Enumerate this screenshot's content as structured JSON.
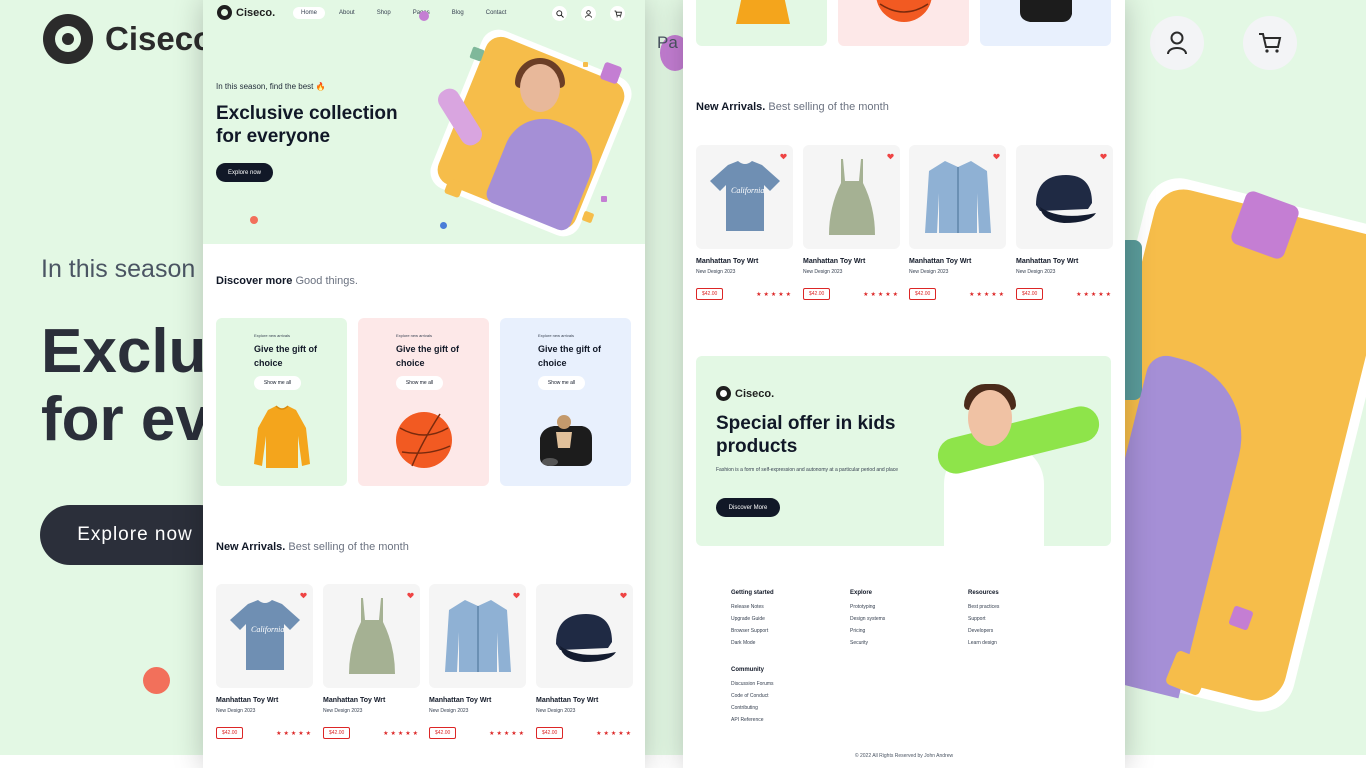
{
  "background": {
    "logo_text": "Ciseco",
    "nav_partial": "Pa",
    "season_text": "In this season",
    "title_lines": [
      "Exclus",
      "for ev"
    ],
    "explore_label": "Explore now",
    "icons": [
      "user-icon",
      "cart-icon"
    ]
  },
  "page_a": {
    "logo_text": "Ciseco.",
    "nav": [
      "Home",
      "About",
      "Shop",
      "Pages",
      "Blog",
      "Contact"
    ],
    "hero": {
      "season": "In this season, find the best 🔥",
      "title": "Exclusive collection for everyone",
      "button": "Explore now"
    },
    "discover": {
      "title": "Discover more",
      "sub": "Good things."
    },
    "gift_cards": [
      {
        "small": "Explore new arrivals",
        "title": "Give the gift of choice",
        "button": "Show me all",
        "image": "sweater",
        "color": "#e3f8e4"
      },
      {
        "small": "Explore new arrivals",
        "title": "Give the gift of choice",
        "button": "Show me all",
        "image": "basketball",
        "color": "#fde8e8"
      },
      {
        "small": "Explore new arrivals",
        "title": "Give the gift of choice",
        "button": "Show me all",
        "image": "pet-carrier",
        "color": "#e8f0fd"
      }
    ],
    "arrivals": {
      "title": "New Arrivals.",
      "sub": "Best selling of the month"
    },
    "products": [
      {
        "name": "Manhattan Toy Wrt",
        "sub": "New Design 2023",
        "price": "$42.00",
        "stars": "★★★★★",
        "image": "tshirt"
      },
      {
        "name": "Manhattan Toy Wrt",
        "sub": "New Design 2023",
        "price": "$42.00",
        "stars": "★★★★★",
        "image": "dress"
      },
      {
        "name": "Manhattan Toy Wrt",
        "sub": "New Design 2023",
        "price": "$42.00",
        "stars": "★★★★★",
        "image": "denim-jacket"
      },
      {
        "name": "Manhattan Toy Wrt",
        "sub": "New Design 2023",
        "price": "$42.00",
        "stars": "★★★★★",
        "image": "cap"
      }
    ]
  },
  "page_b": {
    "arrivals": {
      "title": "New Arrivals.",
      "sub": "Best selling of the month"
    },
    "products": [
      {
        "name": "Manhattan Toy Wrt",
        "sub": "New Design 2023",
        "price": "$42.00",
        "stars": "★★★★★"
      },
      {
        "name": "Manhattan Toy Wrt",
        "sub": "New Design 2023",
        "price": "$42.00",
        "stars": "★★★★★"
      },
      {
        "name": "Manhattan Toy Wrt",
        "sub": "New Design 2023",
        "price": "$42.00",
        "stars": "★★★★★"
      },
      {
        "name": "Manhattan Toy Wrt",
        "sub": "New Design 2023",
        "price": "$42.00",
        "stars": "★★★★★"
      }
    ],
    "kids": {
      "logo_text": "Ciseco.",
      "title": "Special offer in kids products",
      "text": "Fashion is a form of self-expression and autonomy at a particular period and place",
      "button": "Discover More"
    },
    "footer": {
      "getting_started": {
        "title": "Getting started",
        "links": [
          "Release Notes",
          "Upgrade Guide",
          "Browser Support",
          "Dark Mode"
        ]
      },
      "explore": {
        "title": "Explore",
        "links": [
          "Prototyping",
          "Design systems",
          "Pricing",
          "Security"
        ]
      },
      "resources": {
        "title": "Resources",
        "links": [
          "Best practices",
          "Support",
          "Developers",
          "Learn design"
        ]
      },
      "community": {
        "title": "Community",
        "links": [
          "Discussion Forums",
          "Code of Conduct",
          "Contributing",
          "API Reference"
        ]
      },
      "copyright": "© 2022 All Rights Reserved by John Andrew"
    }
  }
}
